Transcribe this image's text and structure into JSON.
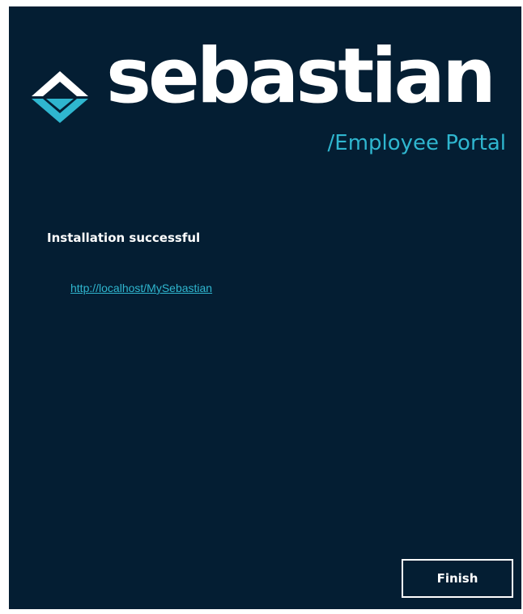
{
  "logo": {
    "wordmark": "sebastian",
    "tagline": "/Employee Portal",
    "icon": "sebastian-diamond-logo"
  },
  "content": {
    "status_text": "Installation successful",
    "portal_url": "http://localhost/MySebastian"
  },
  "footer": {
    "finish_label": "Finish"
  },
  "colors": {
    "background": "#041e33",
    "accent": "#2fb6cf",
    "text": "#ffffff"
  }
}
